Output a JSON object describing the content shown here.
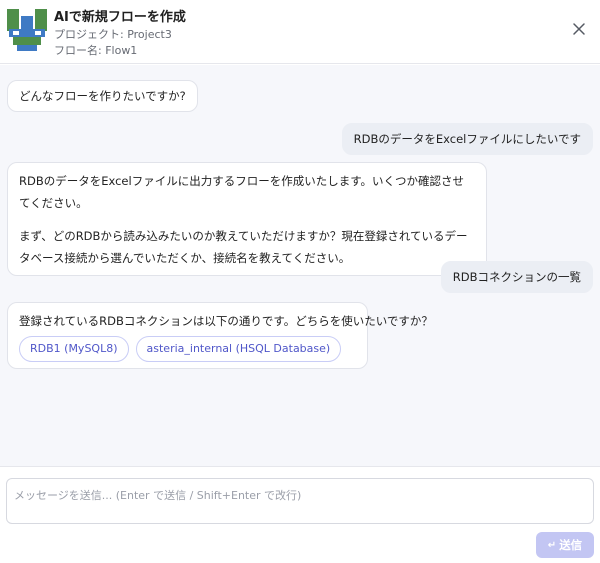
{
  "header": {
    "title": "AIで新規フローを作成",
    "project": "プロジェクト: Project3",
    "flow": "フロー名: Flow1"
  },
  "icons": {
    "logo": "asteria-logo-icon",
    "close": "close-icon",
    "send": "enter-arrow-icon"
  },
  "colors": {
    "accent": "#5057c9",
    "send_button": "#c3c6f3",
    "chat_background": "#f6f7fb",
    "user_bubble": "#ebeef4"
  },
  "messages": {
    "m1": "どんなフローを作りたいですか?",
    "m2": "RDBのデータをExcelファイルにしたいです",
    "m3_p1": "RDBのデータをExcelファイルに出力するフローを作成いたします。いくつか確認させてください。",
    "m3_p2": "まず、どのRDBから読み込みたいのか教えていただけますか？現在登録されているデータベース接続から選んでいただくか、接続名を教えてください。",
    "m4": "RDBコネクションの一覧",
    "m5": "登録されているRDBコネクションは以下の通りです。どちらを使いたいですか？",
    "options": [
      "RDB1 (MySQL8)",
      "asteria_internal (HSQL Database)"
    ]
  },
  "composer": {
    "placeholder": "メッセージを送信... (Enter で送信 / Shift+Enter で改行)",
    "value": "",
    "send_label": "送信",
    "send_glyph": "↵"
  }
}
